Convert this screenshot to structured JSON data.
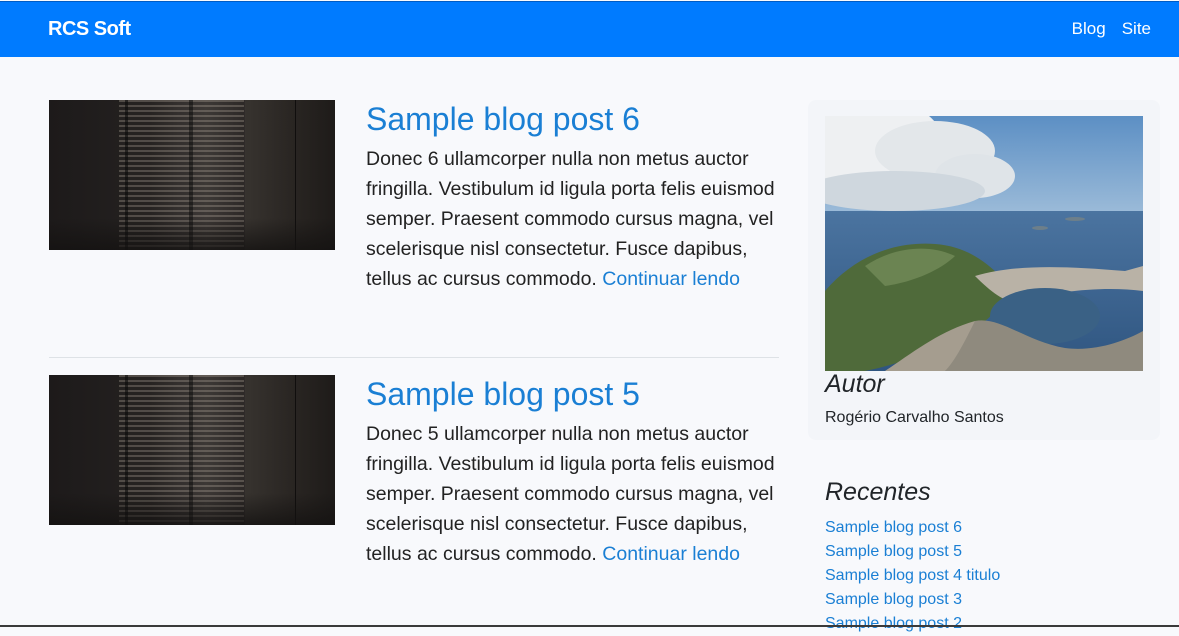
{
  "navbar": {
    "brand": "RCS Soft",
    "links": [
      "Blog",
      "Site"
    ],
    "color": "#007bff"
  },
  "posts": [
    {
      "title": "Sample blog post 6",
      "excerpt": "Donec 6 ullamcorper nulla non metus auctor fringilla. Vestibulum id ligula porta felis euismod semper. Praesent commodo cursus magna, vel scelerisque nisl consectetur. Fusce dapibus, tellus ac cursus commodo.",
      "read_more": "Continuar lendo"
    },
    {
      "title": "Sample blog post 5",
      "excerpt": "Donec 5 ullamcorper nulla non metus auctor fringilla. Vestibulum id ligula porta felis euismod semper. Praesent commodo cursus magna, vel scelerisque nisl consectetur. Fusce dapibus, tellus ac cursus commodo.",
      "read_more": "Continuar lendo"
    }
  ],
  "sidebar": {
    "about_title": "Autor",
    "author_name": "Rogério Carvalho Santos",
    "recent_title": "Recentes",
    "recent_posts": [
      "Sample blog post 6",
      "Sample blog post 5",
      "Sample blog post 4 titulo",
      "Sample blog post 3",
      "Sample blog post 2"
    ]
  },
  "colors": {
    "link": "#1a7fd4",
    "background": "#f8f9fc"
  },
  "icons": {
    "post_thumbnail": "window-blinds-photo",
    "author_photo": "rio-de-janeiro-aerial-photo"
  }
}
